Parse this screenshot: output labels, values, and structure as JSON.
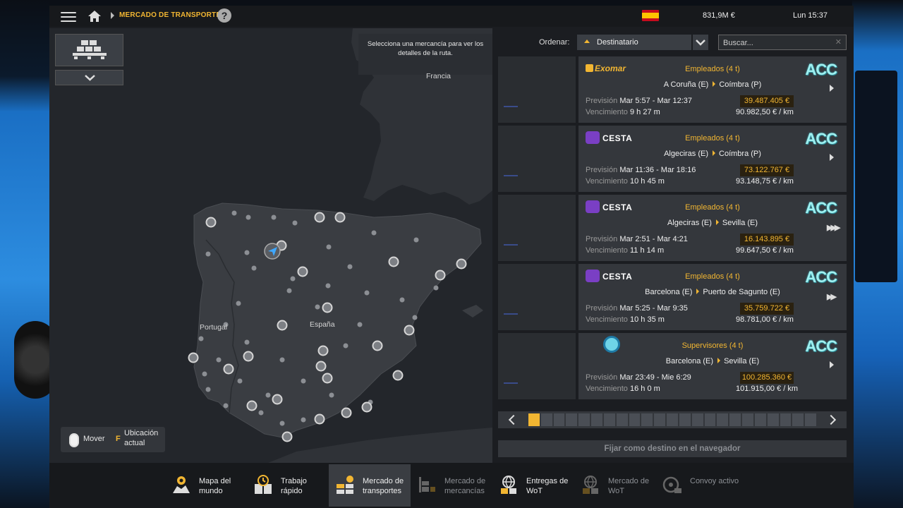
{
  "topbar": {
    "breadcrumb": "MERCADO DE TRANSPORTES",
    "help": "?",
    "money": "831,9M  €",
    "clock": "Lun 15:37"
  },
  "map": {
    "tooltip": "Selecciona una mercancía para ver los detalles de la ruta.",
    "labels": {
      "francia": "Francia",
      "portugal": "Portugal",
      "espana": "España"
    },
    "hint": {
      "move": "Mover",
      "key": "F",
      "location": "Ubicación actual"
    }
  },
  "sort": {
    "label": "Ordenar:",
    "value": "Destinatario"
  },
  "search": {
    "placeholder": "Buscar...",
    "clear": "✕"
  },
  "offers": [
    {
      "company_logo": "Exomar",
      "role": "Empleados (4 t)",
      "origin": "A Coruña (E)",
      "destination": "Coímbra (P)",
      "forecast_label": "Previsión",
      "forecast": "Mar 5:57 - Mar 12:37",
      "expiry_label": "Vencimiento",
      "expiry": "9 h 27 m",
      "price": "39.487.405 €",
      "per_km": "90.982,50 € / km",
      "action_icon": "play"
    },
    {
      "company_logo": "CESTA",
      "role": "Empleados (4 t)",
      "origin": "Algeciras (E)",
      "destination": "Coímbra (P)",
      "forecast_label": "Previsión",
      "forecast": "Mar 11:36 - Mar 18:16",
      "expiry_label": "Vencimiento",
      "expiry": "10 h 45 m",
      "price": "73.122.767 €",
      "per_km": "93.148,75 € / km",
      "action_icon": "play"
    },
    {
      "company_logo": "CESTA",
      "role": "Empleados (4 t)",
      "origin": "Algeciras (E)",
      "destination": "Sevilla (E)",
      "forecast_label": "Previsión",
      "forecast": "Mar 2:51 - Mar 4:21",
      "expiry_label": "Vencimiento",
      "expiry": "11 h 14 m",
      "price": "16.143.895 €",
      "per_km": "99.647,50 € / km",
      "action_icon": "triple-forward"
    },
    {
      "company_logo": "CESTA",
      "role": "Empleados (4 t)",
      "origin": "Barcelona (E)",
      "destination": "Puerto de Sagunto (E)",
      "forecast_label": "Previsión",
      "forecast": "Mar 5:25 - Mar 9:35",
      "expiry_label": "Vencimiento",
      "expiry": "10 h 35 m",
      "price": "35.759.722 €",
      "per_km": "98.781,00 € / km",
      "action_icon": "double-forward"
    },
    {
      "company_logo": "circle",
      "role": "Supervisores (4 t)",
      "origin": "Barcelona (E)",
      "destination": "Sevilla (E)",
      "forecast_label": "Previsión",
      "forecast": "Mar 23:49 - Mie 6:29",
      "expiry_label": "Vencimiento",
      "expiry": "16 h 0 m",
      "price": "100.285.360 €",
      "per_km": "101.915,00 € / km",
      "action_icon": "play"
    }
  ],
  "acc_logo": "ACC",
  "pager": {
    "active_page": 1,
    "page_count": 23
  },
  "set_destination": "Fijar como destino en el navegador",
  "bottom_nav": [
    {
      "label": "Mapa del mundo",
      "icon": "world-map-icon",
      "state": "normal"
    },
    {
      "label": "Trabajo rápido",
      "icon": "quick-job-icon",
      "state": "normal"
    },
    {
      "label": "Mercado de transportes",
      "icon": "freight-market-icon",
      "state": "active"
    },
    {
      "label": "Mercado de mercancías",
      "icon": "cargo-market-icon",
      "state": "dim"
    },
    {
      "label": "Entregas de WoT",
      "icon": "wot-deliveries-icon",
      "state": "normal"
    },
    {
      "label": "Mercado de WoT",
      "icon": "wot-market-icon",
      "state": "dim"
    },
    {
      "label": "Convoy activo",
      "icon": "convoy-icon",
      "state": "dim"
    }
  ],
  "colors": {
    "accent": "#f2b632",
    "panel": "#34373c",
    "background": "#1b1d21",
    "acc_logo": "#9ff0f0"
  }
}
